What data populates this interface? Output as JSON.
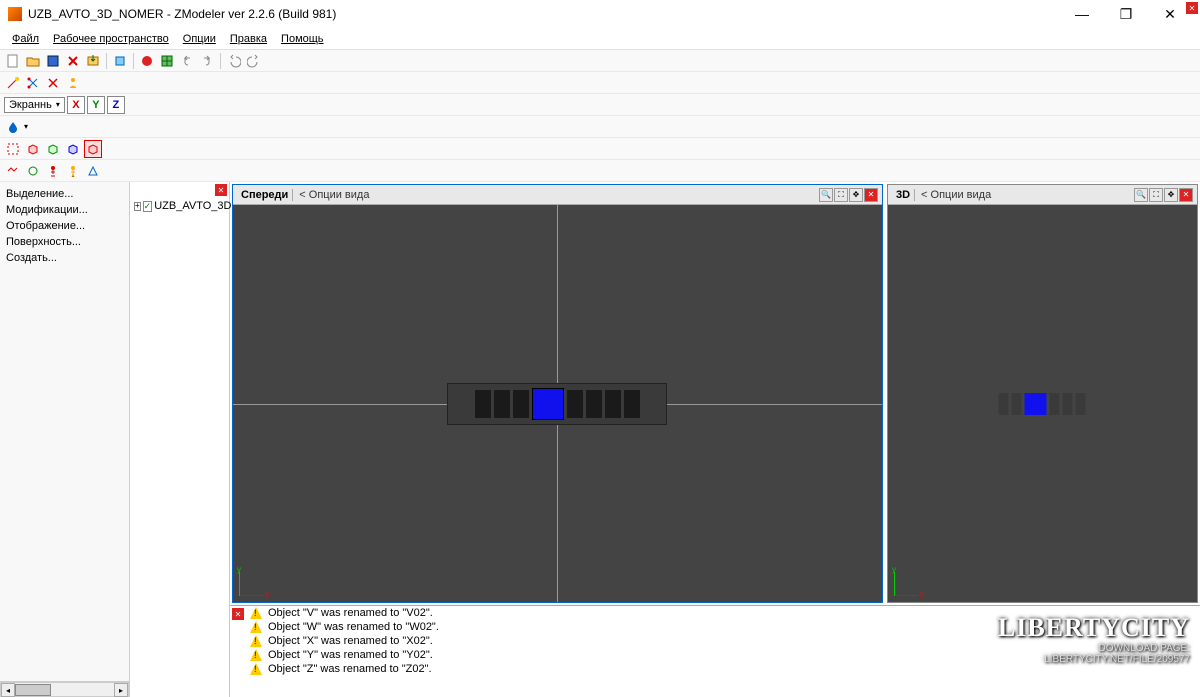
{
  "title": "UZB_AVTO_3D_NOMER - ZModeler ver 2.2.6 (Build 981)",
  "menu": {
    "file": "Файл",
    "workspace": "Рабочее пространство",
    "options": "Опции",
    "edit": "Правка",
    "help": "Помощь"
  },
  "axis_dropdown": "Экраннь",
  "axis": {
    "x": "X",
    "y": "Y",
    "z": "Z"
  },
  "left_rows": {
    "r1": "Выделение...",
    "r2": "Модификации...",
    "r3": "Отображение...",
    "r4": "Поверхность...",
    "r5": "Создать..."
  },
  "tree": {
    "root": "UZB_AVTO_3D"
  },
  "vp": {
    "front": "Спереди",
    "d3": "3D",
    "opts": "< Опции вида"
  },
  "log": {
    "l1": "Object \"V\" was renamed to \"V02\".",
    "l2": "Object \"W\" was renamed to \"W02\".",
    "l3": "Object \"X\" was renamed to \"X02\".",
    "l4": "Object \"Y\" was renamed to \"Y02\".",
    "l5": "Object \"Z\" was renamed to \"Z02\"."
  },
  "watermark": {
    "brand": "LIBERTYCITY",
    "l1": "DOWNLOAD PAGE:",
    "l2": "LIBERTYCITY.NET/FILE/209577"
  }
}
